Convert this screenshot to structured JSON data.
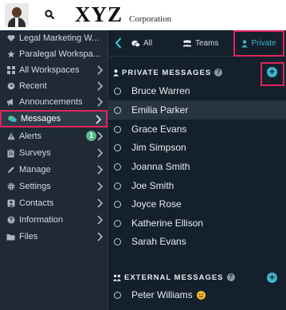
{
  "header": {
    "logo_text": "XYZ",
    "logo_subtext": "Corporation",
    "search_icon": "search-icon"
  },
  "sidebar": {
    "items": [
      {
        "label": "Legal Marketing W...",
        "icon": "heart-icon",
        "chevron": false,
        "badge": null
      },
      {
        "label": "Paralegal Workspa...",
        "icon": "star-icon",
        "chevron": false,
        "badge": null
      },
      {
        "label": "All Workspaces",
        "icon": "grid-icon",
        "chevron": true,
        "badge": null
      },
      {
        "label": "Recent",
        "icon": "clock-icon",
        "chevron": true,
        "badge": null
      },
      {
        "label": "Announcements",
        "icon": "megaphone-icon",
        "chevron": true,
        "badge": null
      },
      {
        "label": "Messages",
        "icon": "chat-bubbles-icon",
        "chevron": true,
        "badge": null
      },
      {
        "label": "Alerts",
        "icon": "alert-icon",
        "chevron": true,
        "badge": "1"
      },
      {
        "label": "Surveys",
        "icon": "clipboard-icon",
        "chevron": true,
        "badge": null
      },
      {
        "label": "Manage",
        "icon": "pencil-icon",
        "chevron": true,
        "badge": null
      },
      {
        "label": "Settings",
        "icon": "gear-icon",
        "chevron": true,
        "badge": null
      },
      {
        "label": "Contacts",
        "icon": "contacts-icon",
        "chevron": true,
        "badge": null
      },
      {
        "label": "Information",
        "icon": "question-icon",
        "chevron": true,
        "badge": null
      },
      {
        "label": "Files",
        "icon": "folder-icon",
        "chevron": true,
        "badge": null
      }
    ],
    "active_item": "Messages"
  },
  "tabs": {
    "all": "All",
    "teams": "Teams",
    "private": "Private",
    "active": "Private"
  },
  "private_messages": {
    "heading": "PRIVATE MESSAGES",
    "help": "?",
    "add": "+",
    "contacts": [
      "Bruce Warren",
      "Emilia Parker",
      "Grace Evans",
      "Jim Simpson",
      "Joanna Smith",
      "Joe Smith",
      "Joyce Rose",
      "Katherine Ellison",
      "Sarah Evans"
    ],
    "highlighted": "Emilia Parker"
  },
  "external_messages": {
    "heading": "EXTERNAL MESSAGES",
    "help": "?",
    "add": "+",
    "contacts": [
      "Peter Williams"
    ]
  },
  "colors": {
    "sidebar_bg": "#1f2a35",
    "panel_bg": "#14202b",
    "accent": "#3fb6c9",
    "highlight_frame": "#e0245e",
    "badge": "#58b98d"
  }
}
